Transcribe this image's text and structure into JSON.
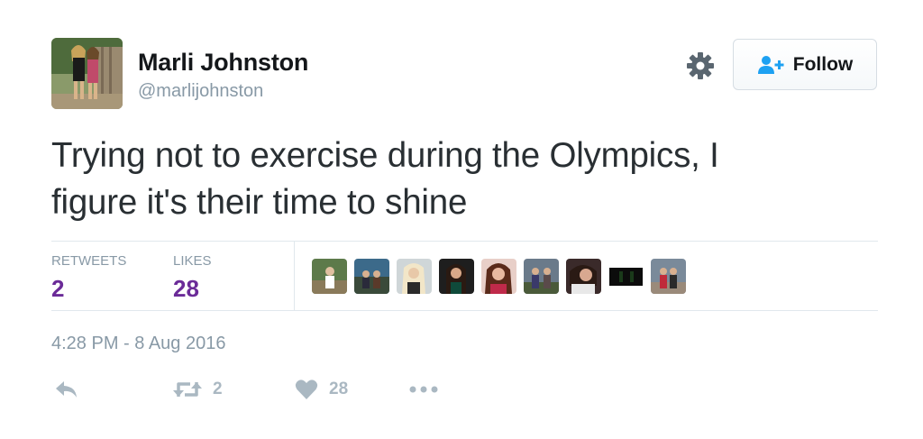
{
  "user": {
    "name": "Marli Johnston",
    "handle": "@marlijohnston"
  },
  "follow_button": {
    "label": "Follow"
  },
  "tweet": {
    "text_line1": "Trying not to exercise during the Olympics, I",
    "text_line2": "figure it's their time to shine",
    "timestamp": "4:28 PM - 8 Aug 2016"
  },
  "stats": {
    "retweets_label": "RETWEETS",
    "retweets_count": "2",
    "likes_label": "LIKES",
    "likes_count": "28"
  },
  "actions": {
    "retweet_count": "2",
    "like_count": "28"
  },
  "colors": {
    "count_purple": "#6b2b98",
    "follow_icon_blue": "#1da1f2",
    "muted_gray": "#8899a6",
    "action_gray": "#aab8c2"
  },
  "icons": [
    "gear-icon",
    "follow-person-plus-icon",
    "reply-icon",
    "retweet-icon",
    "heart-icon",
    "more-dots-icon"
  ]
}
